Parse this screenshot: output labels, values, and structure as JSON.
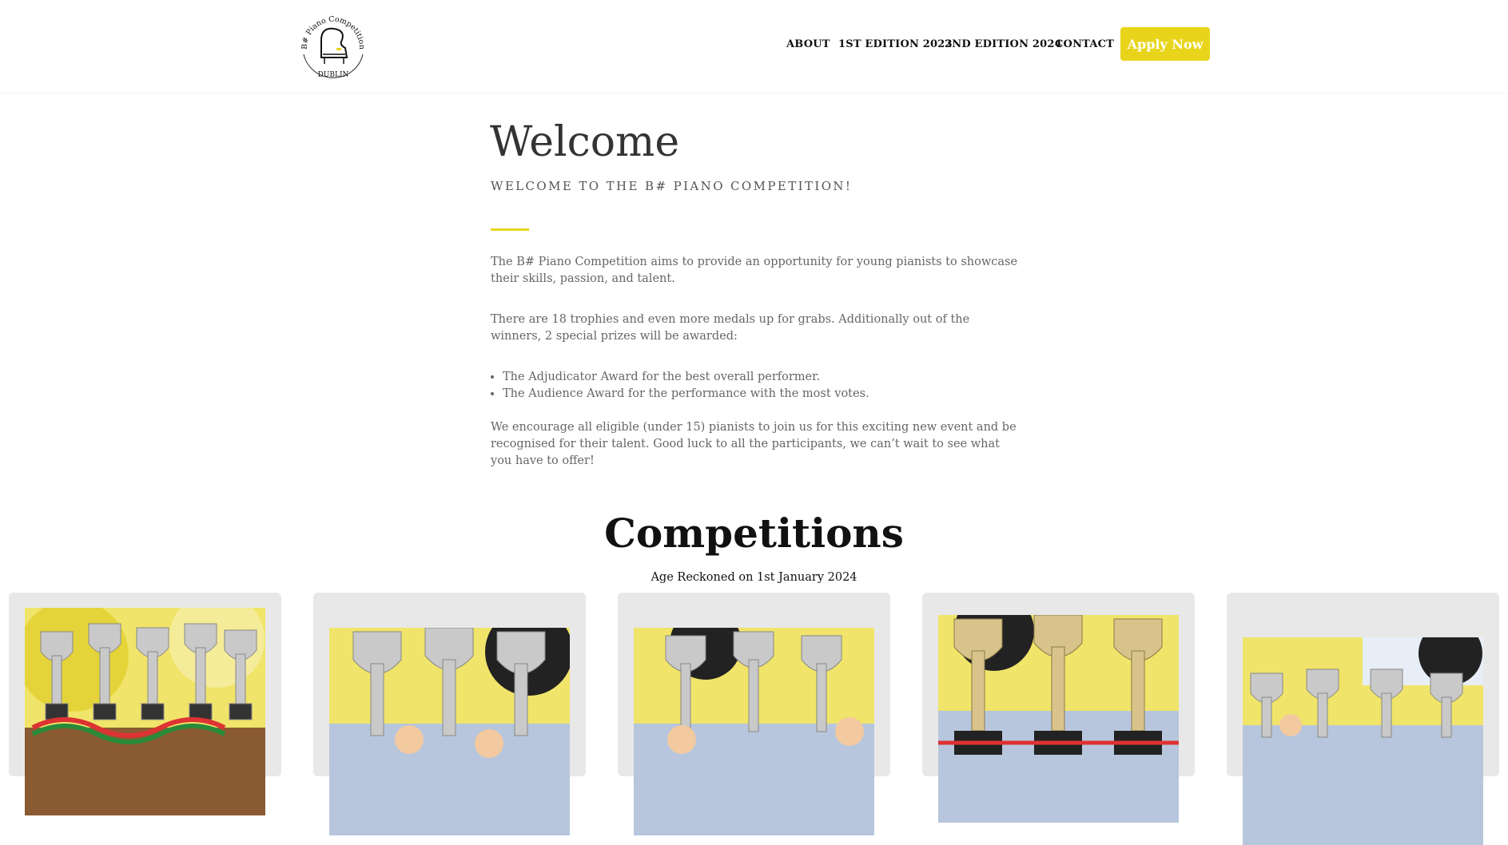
{
  "header": {
    "logo_text": [
      "B# Piano Competition",
      "DUBLIN"
    ],
    "nav": [
      {
        "label": "ABOUT"
      },
      {
        "label": "1ST EDITION 2023"
      },
      {
        "label": "2ND EDITION 2024"
      },
      {
        "label": "CONTACT"
      }
    ],
    "apply_label": "Apply Now"
  },
  "welcome": {
    "title": "Welcome",
    "subtitle": "WELCOME TO THE B# PIANO COMPETITION!",
    "para1": "The B# Piano Competition aims to provide an opportunity for young pianists to showcase their skills, passion, and talent.",
    "para2": "There are 18 trophies and even more medals up for grabs. Additionally out of the winners, 2 special prizes will be awarded:",
    "awards": [
      "The Adjudicator Award for the best overall performer.",
      "The Audience Award for the performance with the most votes."
    ],
    "para3": "We encourage all eligible (under 15) pianists to join us for this exciting new event and be recognised for their talent. Good luck to all the participants, we can’t wait to see what you have to offer!"
  },
  "competitions": {
    "title": "Competitions",
    "subtitle": "Age Reckoned on 1st January 2024",
    "cards": [
      {
        "image": "trophies-photo"
      },
      {
        "image": "trophies-photo"
      },
      {
        "image": "trophies-photo"
      },
      {
        "image": "trophies-photo"
      },
      {
        "image": "trophies-photo"
      }
    ]
  },
  "colors": {
    "accent": "#e8d51b",
    "background": "#ffffff",
    "card_bg": "#e8e8e8"
  }
}
